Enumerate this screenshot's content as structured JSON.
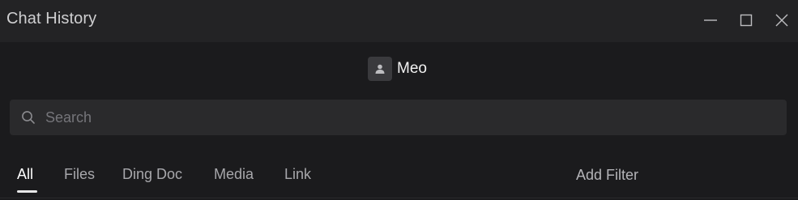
{
  "window": {
    "title": "Chat History"
  },
  "contact": {
    "name": "Meo",
    "avatar_icon": "user-icon"
  },
  "search": {
    "placeholder": "Search",
    "value": ""
  },
  "tabs": [
    {
      "label": "All",
      "active": true
    },
    {
      "label": "Files",
      "active": false
    },
    {
      "label": "Ding Doc",
      "active": false
    },
    {
      "label": "Media",
      "active": false
    },
    {
      "label": "Link",
      "active": false
    }
  ],
  "filter": {
    "add_label": "Add Filter"
  },
  "colors": {
    "background": "#1b1b1d",
    "titlebar": "#232325",
    "search_bg": "#2a2a2c",
    "text_active": "#ffffff",
    "text_inactive": "#a7a7ab"
  }
}
